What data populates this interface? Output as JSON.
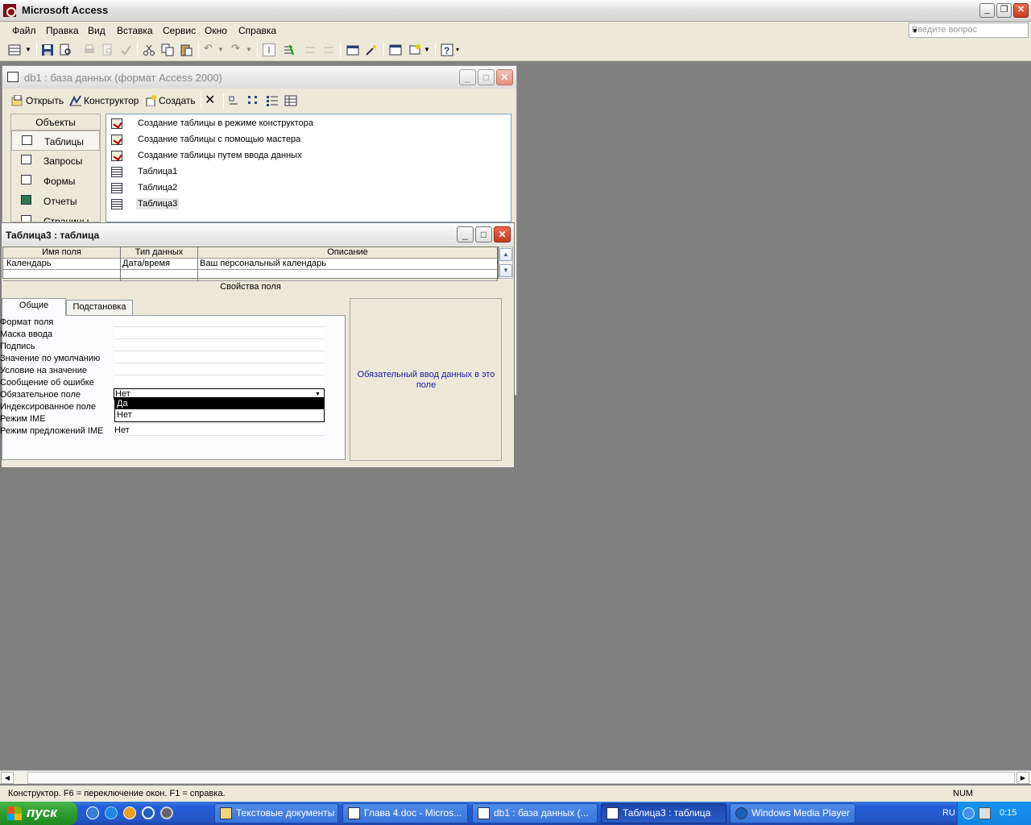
{
  "app": {
    "title": "Microsoft Access"
  },
  "menubar": {
    "items": [
      "Файл",
      "Правка",
      "Вид",
      "Вставка",
      "Сервис",
      "Окно",
      "Справка"
    ]
  },
  "help": {
    "placeholder": "Введите вопрос"
  },
  "db_window": {
    "title": "db1 : база данных (формат Access 2000)",
    "toolbar": {
      "open": "Открыть",
      "design": "Конструктор",
      "create": "Создать"
    },
    "objects_header": "Объекты",
    "objects": [
      "Таблицы",
      "Запросы",
      "Формы",
      "Отчеты",
      "Страницы"
    ],
    "list": [
      "Создание таблицы в режиме конструктора",
      "Создание таблицы с помощью мастера",
      "Создание таблицы путем ввода данных",
      "Таблица1",
      "Таблица2",
      "Таблица3"
    ]
  },
  "table_window": {
    "title": "Таблица3 : таблица",
    "columns": [
      "Имя поля",
      "Тип данных",
      "Описание"
    ],
    "rows": [
      {
        "name": "Календарь",
        "type": "Дата/время",
        "desc": "Ваш персональный календарь"
      }
    ],
    "props_title": "Свойства поля",
    "tabs": [
      "Общие",
      "Подстановка"
    ],
    "properties": [
      {
        "label": "Формат поля",
        "value": ""
      },
      {
        "label": "Маска ввода",
        "value": ""
      },
      {
        "label": "Подпись",
        "value": ""
      },
      {
        "label": "Значение по умолчанию",
        "value": ""
      },
      {
        "label": "Условие на значение",
        "value": ""
      },
      {
        "label": "Сообщение об ошибке",
        "value": ""
      },
      {
        "label": "Обязательное поле",
        "value": "Нет"
      },
      {
        "label": "Индексированное поле",
        "value": ""
      },
      {
        "label": "Режим IME",
        "value": ""
      },
      {
        "label": "Режим предложений IME",
        "value": "Нет"
      }
    ],
    "dropdown_options": [
      "Да",
      "Нет"
    ],
    "hint": "Обязательный ввод данных в это поле"
  },
  "status": {
    "text": "Конструктор.  F6 = переключение окон.  F1 = справка.",
    "num": "NUM"
  },
  "taskbar": {
    "start": "пуск",
    "tasks": [
      "Текстовые документы",
      "Глава 4.doc - Micros...",
      "db1 : база данных (...",
      "Таблица3 : таблица",
      "Windows Media Player"
    ],
    "lang": "RU",
    "clock": "0:15"
  }
}
